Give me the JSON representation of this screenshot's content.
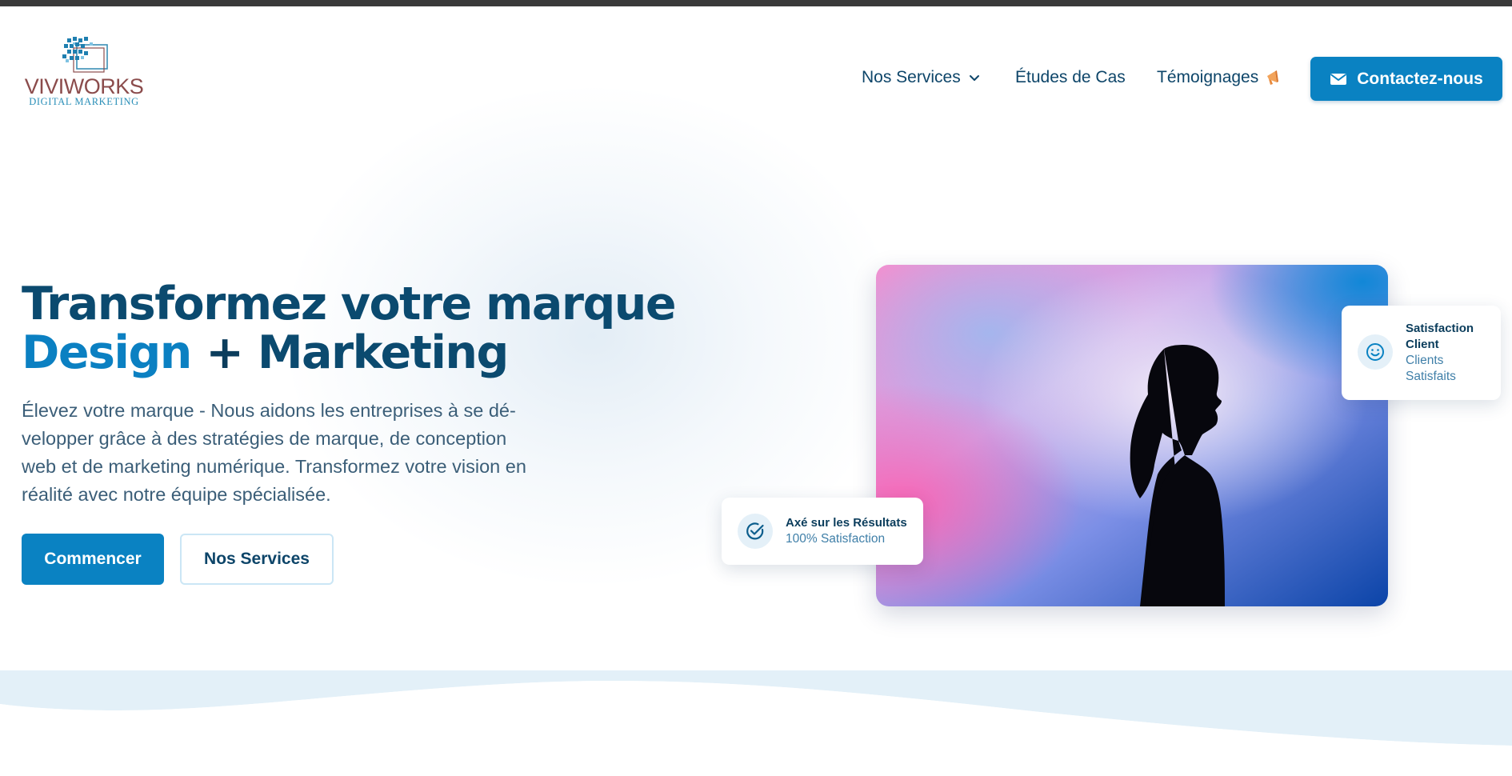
{
  "brand": {
    "name": "VIVIWORKS",
    "tagline": "DIGITAL MARKETING",
    "accent_color": "#0a82c2",
    "dark_color": "#0b3d5c"
  },
  "nav": {
    "items": [
      {
        "label": "Nos Services",
        "icon": "chevron-down-icon"
      },
      {
        "label": "Études de Cas"
      },
      {
        "label": "Témoignages",
        "icon": "megaphone-emoji-icon"
      }
    ],
    "cta_label": "Contactez-nous",
    "cta_icon": "envelope-icon"
  },
  "hero": {
    "title_line1": "Transformez votre marque",
    "title_word_a": "Design",
    "title_plus": "+",
    "title_word_b": "Marketing",
    "description": "Élevez votre marque - Nous aidons les entreprises à se dé-velopper grâce à des stratégies de marque, de conception web et de marketing numérique. Transformez votre vision en réalité avec notre équipe spécialisée.",
    "primary_button": "Commencer",
    "secondary_button": "Nos Services",
    "image_icon": "woman-silhouette-photo"
  },
  "cards": {
    "results": {
      "title": "Axé sur les Résultats",
      "subtitle": "100% Satisfaction",
      "icon": "check-circle-icon"
    },
    "satisfaction": {
      "title": "Satisfaction Client",
      "subtitle": "Clients Satisfaits",
      "icon": "smiley-icon"
    }
  }
}
